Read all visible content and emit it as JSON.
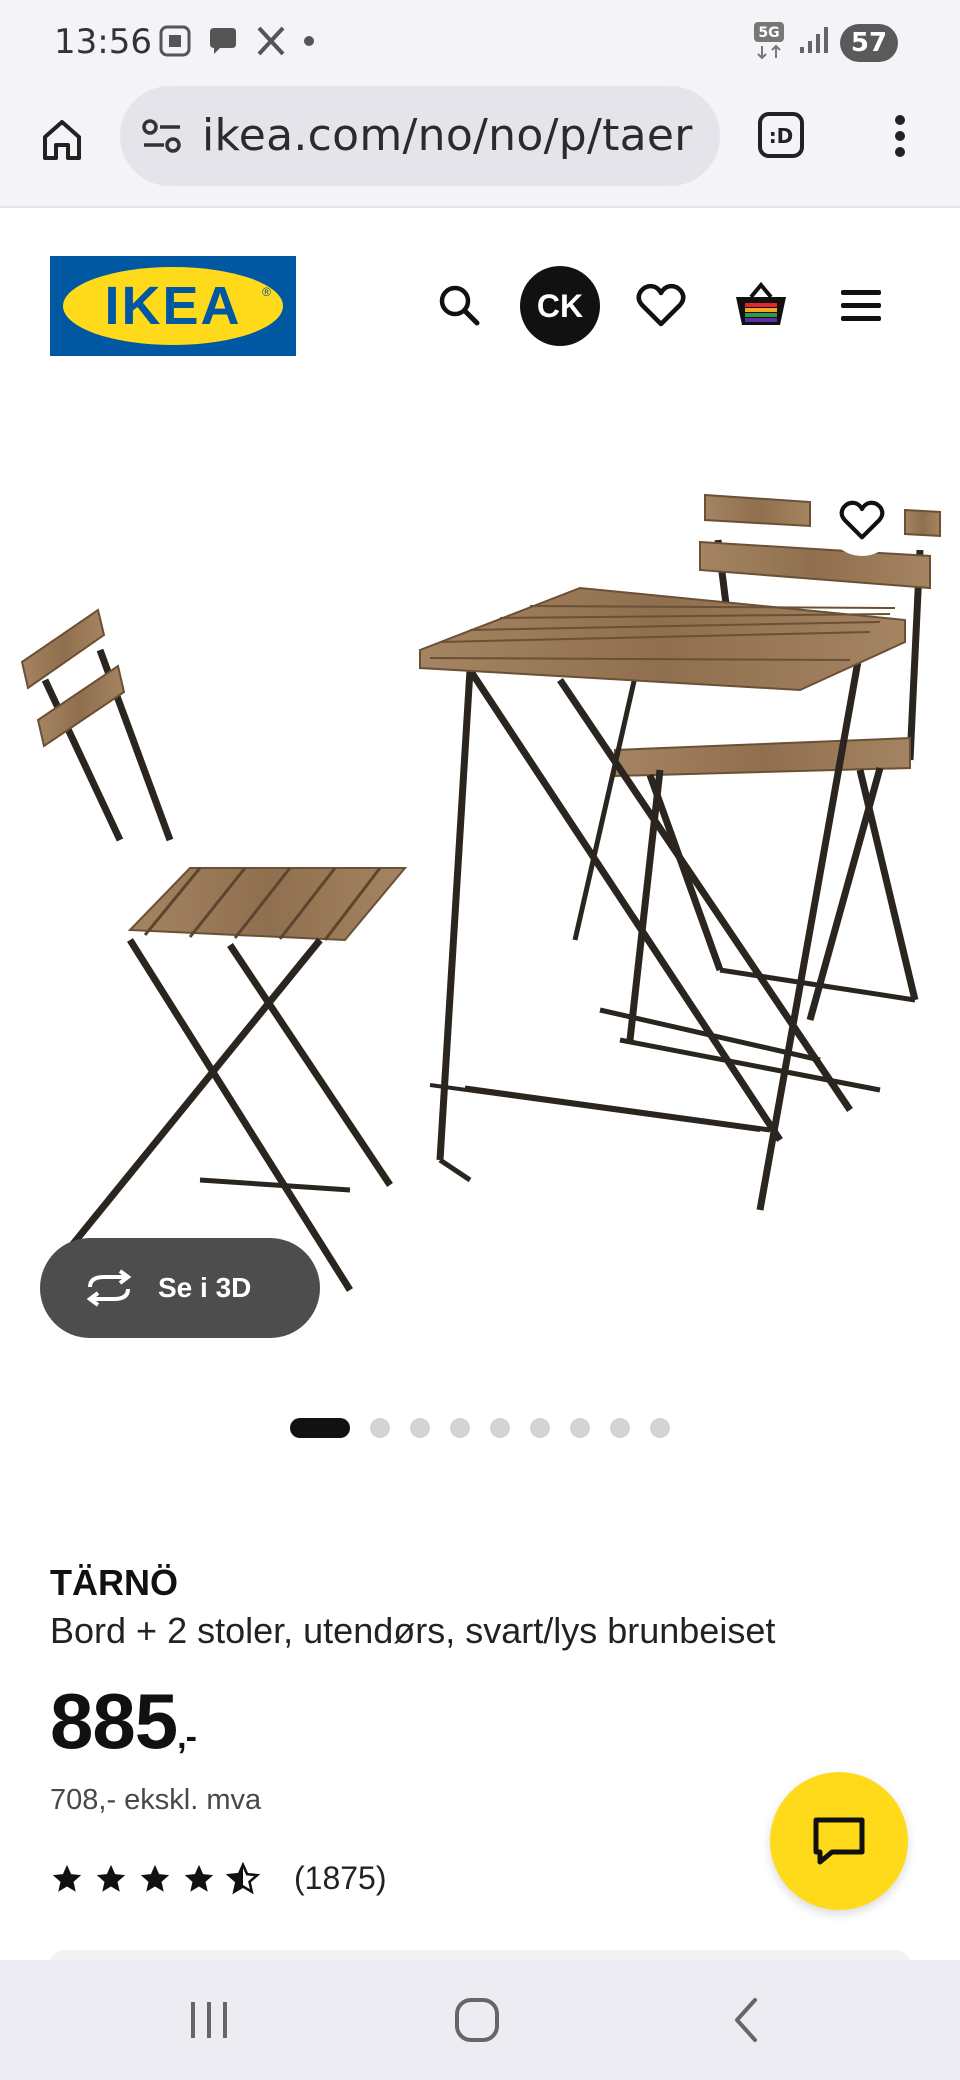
{
  "status_bar": {
    "time": "13:56",
    "network": "5G",
    "battery": "57",
    "left_icons": [
      "screen-capture-icon",
      "chat-bubble-icon",
      "x-logo-icon",
      "dot-icon"
    ],
    "right_icons": [
      "network-5g-icon",
      "signal-icon",
      "battery-icon"
    ]
  },
  "browser": {
    "url": "ikea.com/no/no/p/taer",
    "home_icon": "home-icon",
    "site_settings_icon": "tune-icon",
    "tab_icon": "tab-switcher-icon",
    "tab_label": ":D",
    "menu_icon": "more-vert-icon"
  },
  "header": {
    "logo_text": "IKEA",
    "avatar_initials": "CK",
    "icons": [
      "search-icon",
      "heart-icon",
      "basket-icon",
      "hamburger-icon"
    ]
  },
  "product_image": {
    "view_3d_label": "Se i 3D",
    "carousel_count": 9,
    "carousel_active_index": 0
  },
  "product": {
    "name": "TÄRNÖ",
    "description": "Bord + 2 stoler, utendørs, svart/lys brunbeiset",
    "price": "885",
    "price_suffix": ",-",
    "price_excl_vat": "708,- ekskl. mva",
    "rating": 4.5,
    "rating_max": 5,
    "review_count": "(1875)"
  },
  "colors": {
    "ikea_blue": "#0058a3",
    "ikea_yellow": "#ffda1a",
    "browser_bg": "#f3f3f8",
    "wood": "#9c7b57",
    "metal": "#2b2520"
  },
  "nav_bar": {
    "icons": [
      "recent-apps-icon",
      "home-circle-icon",
      "back-icon"
    ]
  }
}
